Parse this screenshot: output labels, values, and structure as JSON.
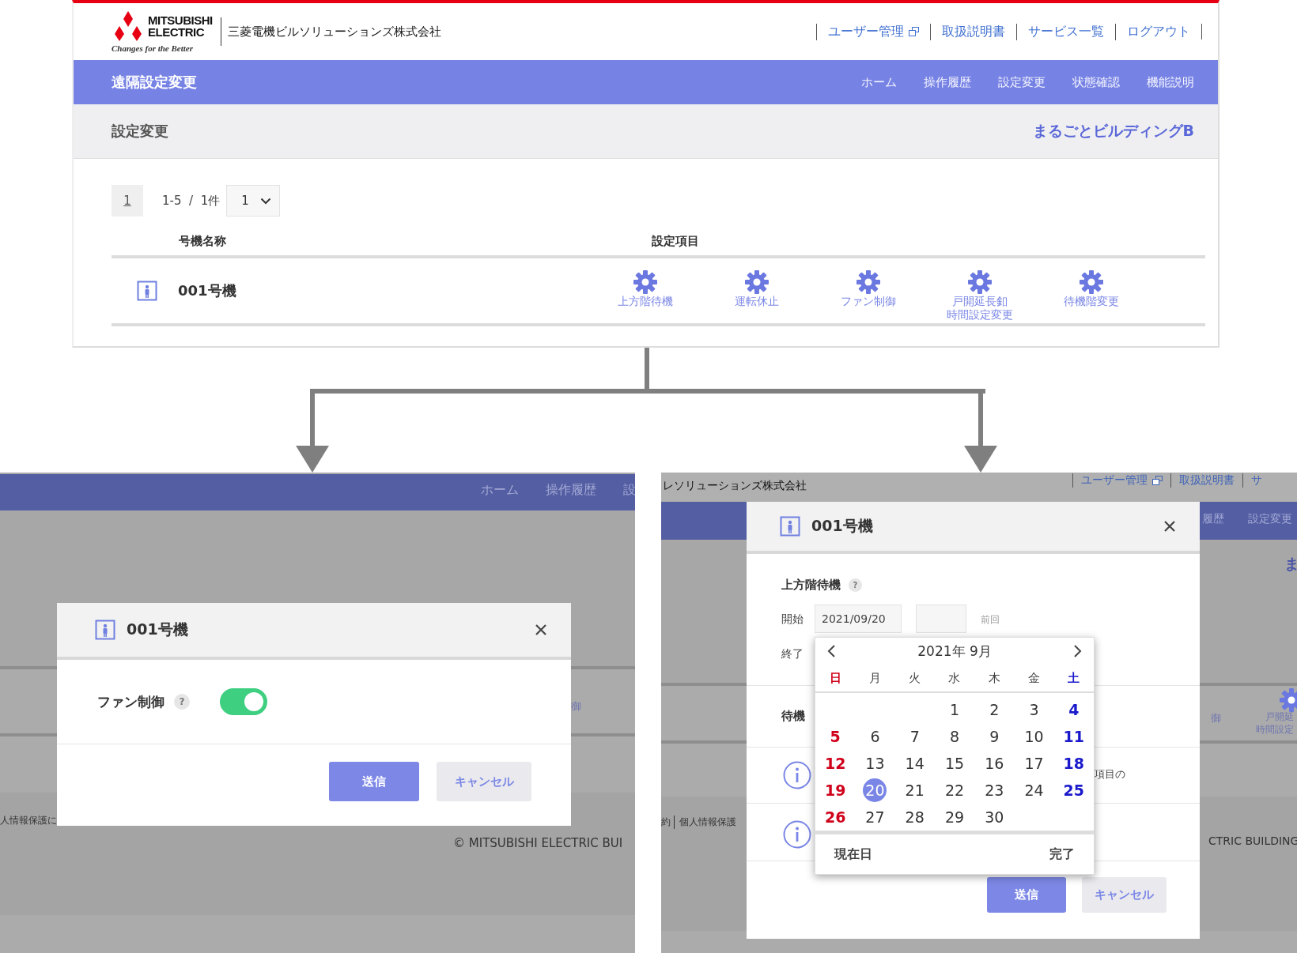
{
  "portal": {
    "logo": {
      "line1": "MITSUBISHI",
      "line2": "ELECTRIC",
      "tagline": "Changes for the Better"
    },
    "company": "三菱電機ビルソリューションズ株式会社",
    "links": [
      {
        "label": "ユーザー管理",
        "external": true
      },
      {
        "label": "取扱説明書",
        "external": false
      },
      {
        "label": "サービス一覧",
        "external": false
      },
      {
        "label": "ログアウト",
        "external": false
      }
    ],
    "app_title": "遠隔設定変更",
    "nav": [
      "ホーム",
      "操作履歴",
      "設定変更",
      "状態確認",
      "機能説明"
    ],
    "page_title": "設定変更",
    "building": "まるごとビルディングB",
    "pagination": {
      "page": "1",
      "range": "1-5  /  1件",
      "per_page": "1"
    },
    "table": {
      "columns": [
        "号機名称",
        "設定項目"
      ],
      "rows": [
        {
          "name": "001号機",
          "settings": [
            [
              "上方階待機"
            ],
            [
              "運転休止"
            ],
            [
              "ファン制御"
            ],
            [
              "戸開延長釦",
              "時間設定変更"
            ],
            [
              "待機階変更"
            ]
          ]
        }
      ]
    }
  },
  "fan_view": {
    "backdrop": {
      "nav": [
        "ホーム",
        "操作履歴",
        "設"
      ],
      "cells": [
        "御"
      ],
      "footer_link": "人情報保護に",
      "copyright": "© MITSUBISHI ELECTRIC BUI"
    },
    "dialog": {
      "title": "001号機",
      "label": "ファン制御",
      "help": "?",
      "on": true,
      "buttons": [
        "送信",
        "キャンセル"
      ]
    }
  },
  "calendar_view": {
    "backdrop": {
      "company": "レソリューションズ株式会社",
      "links": [
        {
          "label": "ユーザー管理",
          "external": true
        },
        {
          "label": "取扱説明書",
          "external": false
        },
        {
          "label": "サ",
          "external": false
        }
      ],
      "nav": [
        "履歴",
        "設定変更"
      ],
      "building": "ま",
      "cells": [
        "御",
        "戸開延",
        "時間設定"
      ],
      "footer_links": [
        "約",
        "個人情報保護"
      ],
      "copyright": "CTRIC BUILDING"
    },
    "dialog": {
      "title": "001号機",
      "section": "上方階待機",
      "help": "?",
      "start_label": "開始",
      "start_date": "2021/09/20",
      "previous": "前回",
      "end_label": "終了",
      "floor_label": "待機",
      "info_text": "項目の",
      "buttons": [
        "送信",
        "キャンセル"
      ]
    },
    "calendar": {
      "month": "2021年 9月",
      "weekdays": [
        "日",
        "月",
        "火",
        "水",
        "木",
        "金",
        "土"
      ],
      "weeks": [
        {
          "days": [
            {
              "kind": "empty"
            },
            {
              "kind": "empty"
            },
            {
              "kind": "empty"
            },
            {
              "kind": "day",
              "d": "1",
              "selected": false
            },
            {
              "kind": "day",
              "d": "2",
              "selected": false
            },
            {
              "kind": "day",
              "d": "3",
              "selected": false
            },
            {
              "kind": "day",
              "d": "4",
              "selected": false
            }
          ]
        },
        {
          "days": [
            {
              "kind": "day",
              "d": "5",
              "selected": false
            },
            {
              "kind": "day",
              "d": "6",
              "selected": false
            },
            {
              "kind": "day",
              "d": "7",
              "selected": false
            },
            {
              "kind": "day",
              "d": "8",
              "selected": false
            },
            {
              "kind": "day",
              "d": "9",
              "selected": false
            },
            {
              "kind": "day",
              "d": "10",
              "selected": false
            },
            {
              "kind": "day",
              "d": "11",
              "selected": false
            }
          ]
        },
        {
          "days": [
            {
              "kind": "day",
              "d": "12",
              "selected": false
            },
            {
              "kind": "day",
              "d": "13",
              "selected": false
            },
            {
              "kind": "day",
              "d": "14",
              "selected": false
            },
            {
              "kind": "day",
              "d": "15",
              "selected": false
            },
            {
              "kind": "day",
              "d": "16",
              "selected": false
            },
            {
              "kind": "day",
              "d": "17",
              "selected": false
            },
            {
              "kind": "day",
              "d": "18",
              "selected": false
            }
          ]
        },
        {
          "days": [
            {
              "kind": "day",
              "d": "19",
              "selected": false
            },
            {
              "kind": "day",
              "d": "20",
              "selected": true
            },
            {
              "kind": "day",
              "d": "21",
              "selected": false
            },
            {
              "kind": "day",
              "d": "22",
              "selected": false
            },
            {
              "kind": "day",
              "d": "23",
              "selected": false
            },
            {
              "kind": "day",
              "d": "24",
              "selected": false
            },
            {
              "kind": "day",
              "d": "25",
              "selected": false
            }
          ]
        },
        {
          "days": [
            {
              "kind": "day",
              "d": "26",
              "selected": false
            },
            {
              "kind": "day",
              "d": "27",
              "selected": false
            },
            {
              "kind": "day",
              "d": "28",
              "selected": false
            },
            {
              "kind": "day",
              "d": "29",
              "selected": false
            },
            {
              "kind": "day",
              "d": "30",
              "selected": false
            },
            {
              "kind": "empty"
            },
            {
              "kind": "empty"
            }
          ]
        }
      ],
      "today": "現在日",
      "done": "完了"
    }
  }
}
